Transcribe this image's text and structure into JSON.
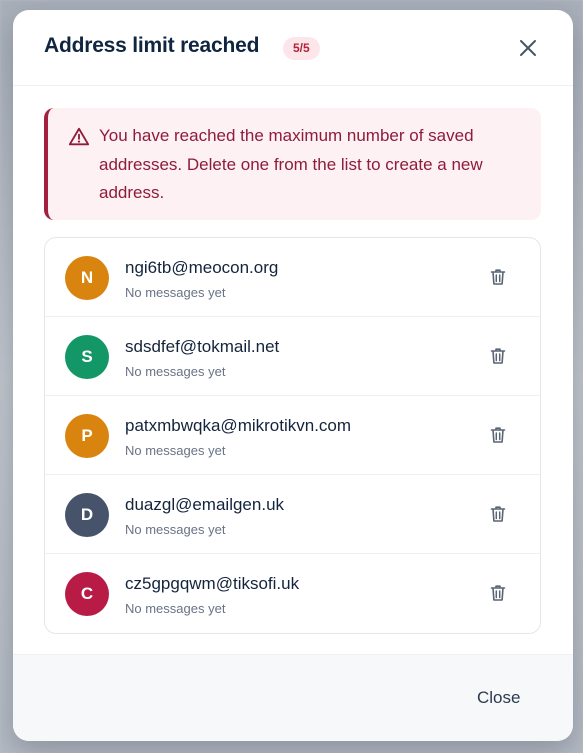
{
  "modal": {
    "title": "Address limit reached",
    "count_badge": "5/5",
    "alert_message": "You have reached the maximum number of saved addresses. Delete one from the list to create a new address.",
    "close_label": "Close"
  },
  "addresses": [
    {
      "initial": "N",
      "email": "ngi6tb@meocon.org",
      "status": "No messages yet",
      "color": "#d9840f"
    },
    {
      "initial": "S",
      "email": "sdsdfef@tokmail.net",
      "status": "No messages yet",
      "color": "#139766"
    },
    {
      "initial": "P",
      "email": "patxmbwqka@mikrotikvn.com",
      "status": "No messages yet",
      "color": "#d9840f"
    },
    {
      "initial": "D",
      "email": "duazgl@emailgen.uk",
      "status": "No messages yet",
      "color": "#46536a"
    },
    {
      "initial": "C",
      "email": "cz5gpgqwm@tiksofi.uk",
      "status": "No messages yet",
      "color": "#b81c46"
    }
  ],
  "icons": {
    "close": "close-icon",
    "warning": "warning-triangle-icon",
    "delete": "trash-icon"
  },
  "colors": {
    "title": "#0f2540",
    "alert_text": "#8e1c3a",
    "alert_bg": "#fdf1f3",
    "alert_border": "#a3213e",
    "badge_bg": "#fde6ea",
    "badge_text": "#b0243a"
  }
}
